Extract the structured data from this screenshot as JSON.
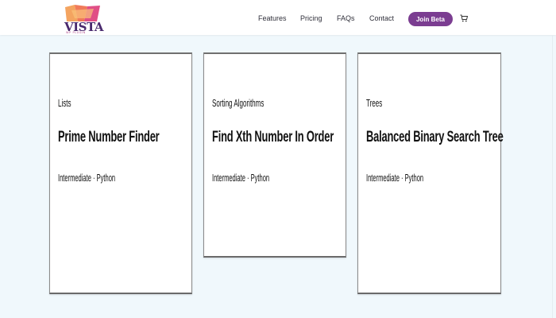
{
  "header": {
    "logo": {
      "name": "VISTA",
      "tagline": "WP PLUGIN"
    },
    "nav": [
      "Features",
      "Pricing",
      "FAQs",
      "Contact"
    ],
    "cta_label": "Join Beta",
    "cart_icon": "cart-icon"
  },
  "colors": {
    "page_background": "#f0f8fc",
    "brand_purple": "#7b3d91",
    "logo_orange": "#f4a460",
    "logo_pink": "#e04f86"
  },
  "cards": [
    {
      "category": "Lists",
      "title": "Prime Number Finder",
      "meta": "Intermediate · Python"
    },
    {
      "category": "Sorting Algorithms",
      "title": "Find Xth Number In Order",
      "meta": "Intermediate · Python"
    },
    {
      "category": "Trees",
      "title": "Balanced Binary Search Tree",
      "meta": "Intermediate · Python"
    }
  ]
}
